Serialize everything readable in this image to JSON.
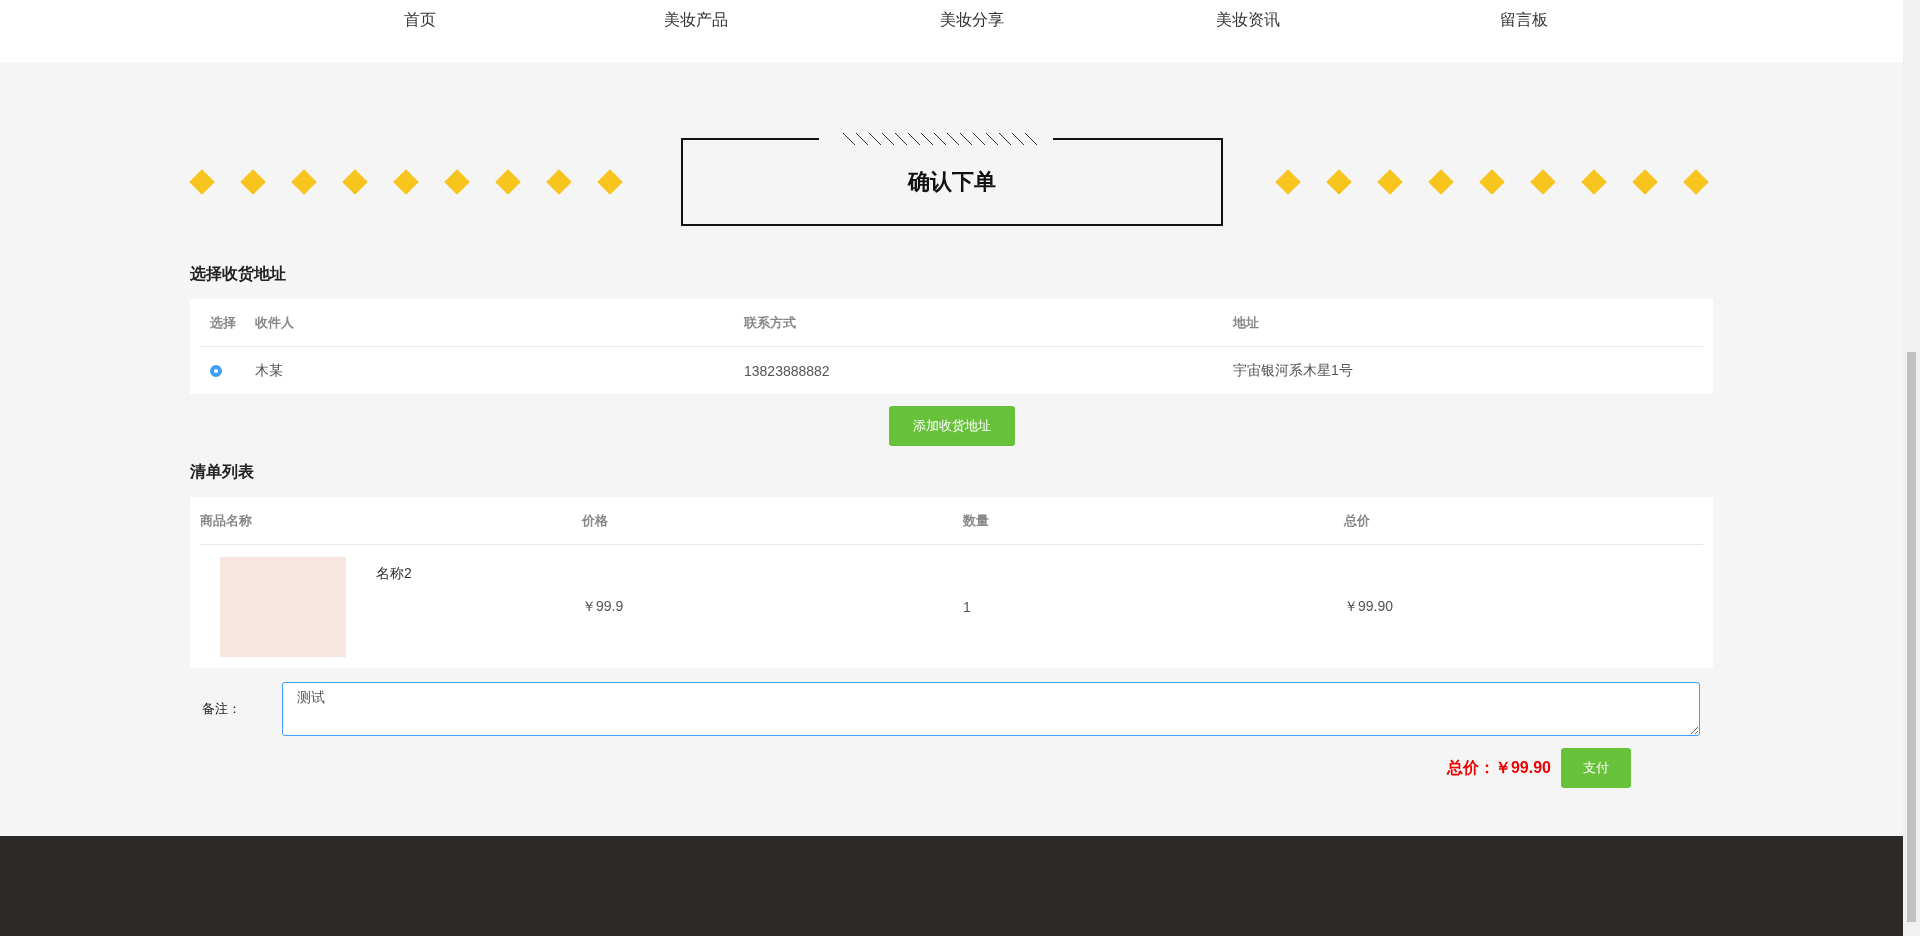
{
  "nav": [
    {
      "label": "首页"
    },
    {
      "label": "美妆产品"
    },
    {
      "label": "美妆分享"
    },
    {
      "label": "美妆资讯"
    },
    {
      "label": "留言板"
    }
  ],
  "title": "确认下单",
  "address_section": {
    "heading": "选择收货地址",
    "columns": [
      "选择",
      "收件人",
      "联系方式",
      "地址"
    ],
    "rows": [
      {
        "selected": true,
        "name": "木某",
        "phone": "13823888882",
        "address": "宇宙银河系木星1号"
      }
    ],
    "add_button": "添加收货地址"
  },
  "order_section": {
    "heading": "清单列表",
    "columns": [
      "商品名称",
      "价格",
      "数量",
      "总价"
    ],
    "rows": [
      {
        "name": "名称2",
        "price": "￥99.9",
        "quantity": "1",
        "total": "￥99.90"
      }
    ]
  },
  "remark": {
    "label": "备注：",
    "value": "测试"
  },
  "total": "总价：￥99.90",
  "pay_button": "支付"
}
